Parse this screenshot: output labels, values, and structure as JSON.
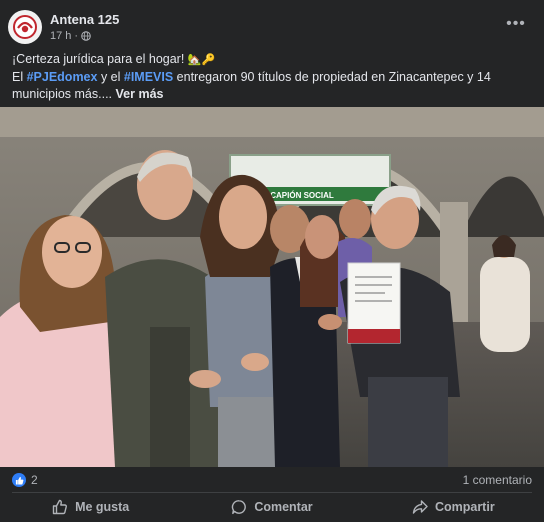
{
  "post": {
    "page_name": "Antena 125",
    "time": "17 h",
    "separator": "·",
    "privacy_icon": "globe-icon",
    "more_label": "•••",
    "text": {
      "intro": "¡Certeza jurídica para el hogar! ",
      "intro_emoji": "🏡🔑",
      "line2_a": "El ",
      "hashtag1": "#PJEdomex",
      "line2_b": " y el ",
      "hashtag2": "#IMEVIS",
      "line2_c": " entregaron 90 títulos de propiedad en Zinacantepec y 14 municipios más.... ",
      "see_more": "Ver más"
    },
    "photo": {
      "banner_text": "DE USUCAPIÓN SOCIAL"
    }
  },
  "stats": {
    "like_count": "2",
    "comments": "1 comentario"
  },
  "actions": {
    "like": "Me gusta",
    "comment": "Comentar",
    "share": "Compartir"
  },
  "colors": {
    "background": "#242526",
    "hashtag": "#5b9cf5",
    "like_badge": "#2e7df6"
  }
}
